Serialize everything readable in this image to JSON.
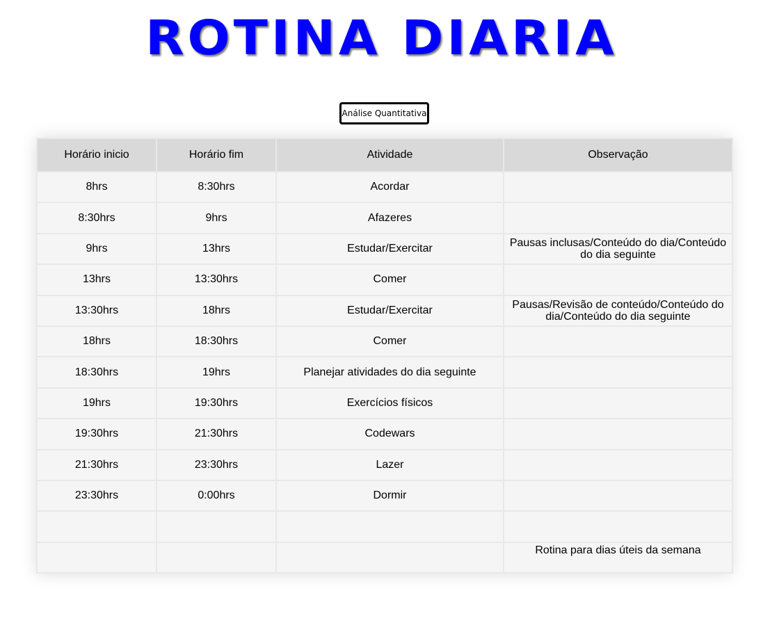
{
  "page": {
    "title": "Rotina Diaria",
    "button_label": "Análise Quantitativa"
  },
  "table": {
    "headers": [
      "Horário inicio",
      "Horário fim",
      "Atividade",
      "Observação"
    ],
    "rows": [
      [
        "8hrs",
        "8:30hrs",
        "Acordar",
        ""
      ],
      [
        "8:30hrs",
        "9hrs",
        "Afazeres",
        ""
      ],
      [
        "9hrs",
        "13hrs",
        "Estudar/Exercitar",
        "Pausas  inclusas/Conteúdo do dia/Conteúdo do dia seguinte"
      ],
      [
        "13hrs",
        "13:30hrs",
        "Comer",
        ""
      ],
      [
        "13:30hrs",
        "18hrs",
        "Estudar/Exercitar",
        "Pausas/Revisão de conteúdo/Conteúdo do dia/Conteúdo do dia seguinte"
      ],
      [
        "18hrs",
        "18:30hrs",
        "Comer",
        ""
      ],
      [
        "18:30hrs",
        "19hrs",
        "Planejar atividades do dia seguinte",
        ""
      ],
      [
        "19hrs",
        "19:30hrs",
        "Exercícios físicos",
        ""
      ],
      [
        "19:30hrs",
        "21:30hrs",
        "Codewars",
        ""
      ],
      [
        "21:30hrs",
        "23:30hrs",
        "Lazer",
        ""
      ],
      [
        "23:30hrs",
        "0:00hrs",
        "Dormir",
        ""
      ],
      [
        "",
        "",
        "",
        ""
      ],
      [
        "",
        "",
        "",
        "Rotina para dias úteis da semana"
      ]
    ]
  },
  "colors": {
    "title": "#0000ff",
    "header_bg": "#d9d9d9",
    "cell_bg": "#f5f5f5",
    "border": "#e8e8e8"
  }
}
